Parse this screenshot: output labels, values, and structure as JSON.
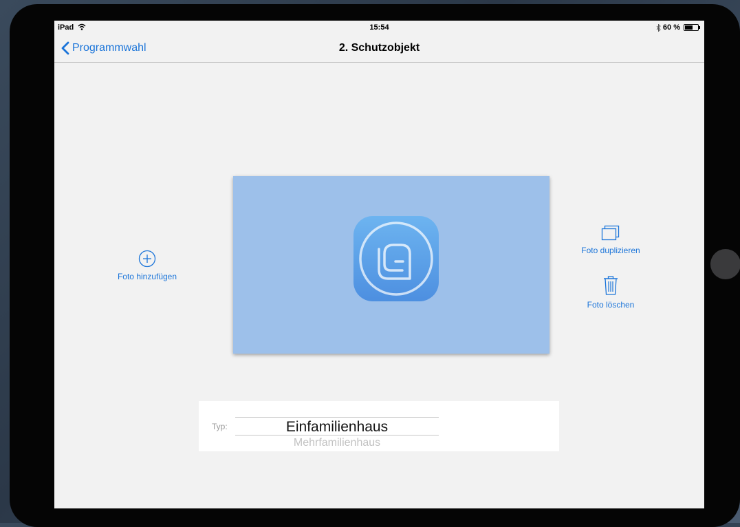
{
  "status_bar": {
    "device": "iPad",
    "time": "15:54",
    "battery": "60 %",
    "battery_level": 0.6
  },
  "nav": {
    "back_label": "Programmwahl",
    "title": "2. Schutzobjekt"
  },
  "actions": {
    "add_photo": "Foto hinzufügen",
    "duplicate_photo": "Foto duplizieren",
    "delete_photo": "Foto löschen"
  },
  "picker": {
    "label": "Typ:",
    "selected": "Einfamilienhaus",
    "next": "Mehrfamilienhaus"
  },
  "colors": {
    "accent": "#1a74d9",
    "photo_placeholder": "#9dc0ea",
    "app_icon": "#5a9fe8"
  },
  "icons": {
    "back": "chevron-left-icon",
    "add": "plus-circle-icon",
    "duplicate": "duplicate-icon",
    "delete": "trash-icon",
    "wifi": "wifi-icon",
    "bluetooth": "bluetooth-icon",
    "battery": "battery-icon"
  }
}
